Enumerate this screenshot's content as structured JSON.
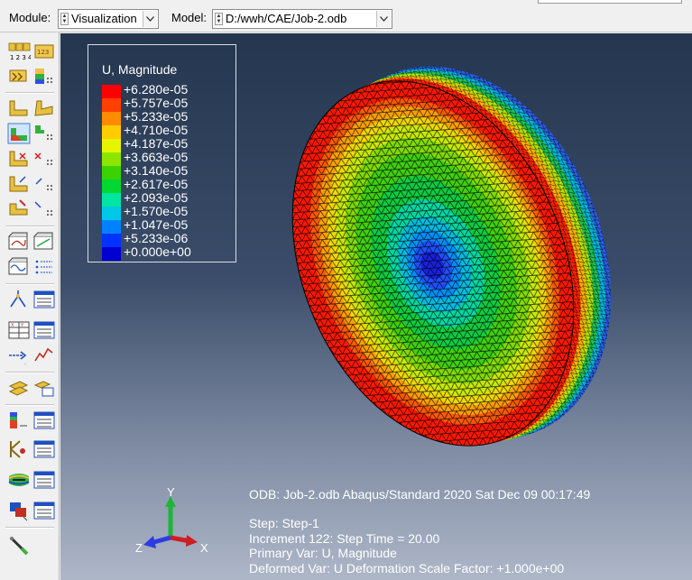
{
  "context_bar": {
    "module_label": "Module:",
    "module_value": "Visualization",
    "model_label": "Model:",
    "model_value": "D:/wwh/CAE/Job-2.odb"
  },
  "toolbox": {
    "icons": [
      "contour-options-icon",
      "result-options-icon",
      "frame-icon",
      "view-cut-icon",
      "plot-undeformed-icon",
      "plot-deformed-icon",
      "plot-contours-icon",
      "contour-style-icon",
      "plot-symbols-icon",
      "symbol-style-icon",
      "plot-material-orientation-icon",
      "material-orientation-style-icon",
      "probe-icon",
      "probe-options-icon",
      "animate-time-history-icon",
      "animate-scale-factor-icon",
      "animate-harmonic-icon",
      "animation-options-icon",
      "create-path-icon",
      "path-manager-icon",
      "create-xy-data-icon",
      "xy-data-manager-icon",
      "free-body-cut-icon",
      "plot-xy-data-icon",
      "display-group-icon",
      "display-group-manager-icon",
      "stream-icon",
      "stream-manager-icon",
      "query-icon",
      "report-manager-icon",
      "view-cut-manager-icon",
      "free-body-manager-icon",
      "overlay-plot-icon",
      "overlay-manager-icon",
      "copy-display-icon",
      "display-manager-icon",
      "edit-tool-icon"
    ]
  },
  "legend": {
    "title": "U, Magnitude",
    "entries": [
      {
        "label": "+6.280e-05",
        "color": "#ff0000"
      },
      {
        "label": "+5.757e-05",
        "color": "#ff4000"
      },
      {
        "label": "+5.233e-05",
        "color": "#ff8c00"
      },
      {
        "label": "+4.710e-05",
        "color": "#ffcc00"
      },
      {
        "label": "+4.187e-05",
        "color": "#e6f500"
      },
      {
        "label": "+3.663e-05",
        "color": "#8ce600"
      },
      {
        "label": "+3.140e-05",
        "color": "#3cd200"
      },
      {
        "label": "+2.617e-05",
        "color": "#00d732"
      },
      {
        "label": "+2.093e-05",
        "color": "#00e6a0"
      },
      {
        "label": "+1.570e-05",
        "color": "#00c8e6"
      },
      {
        "label": "+1.047e-05",
        "color": "#0082ff"
      },
      {
        "label": "+5.233e-06",
        "color": "#0032ff"
      },
      {
        "label": "+0.000e+00",
        "color": "#0000d0"
      }
    ]
  },
  "info": {
    "line1": "ODB: Job-2.odb    Abaqus/Standard 2020    Sat Dec 09 00:17:49",
    "line2": "Step: Step-1",
    "line3": "Increment    122: Step Time =      20.00",
    "line4": "Primary Var: U, Magnitude",
    "line5": "Deformed Var: U   Deformation Scale Factor: +1.000e+00"
  },
  "triad": {
    "y_label": "Y",
    "z_label": "Z",
    "x_label": "X",
    "y_color": "#1fb43c",
    "x_color": "#d01e1e",
    "z_color": "#2d3ce0"
  }
}
